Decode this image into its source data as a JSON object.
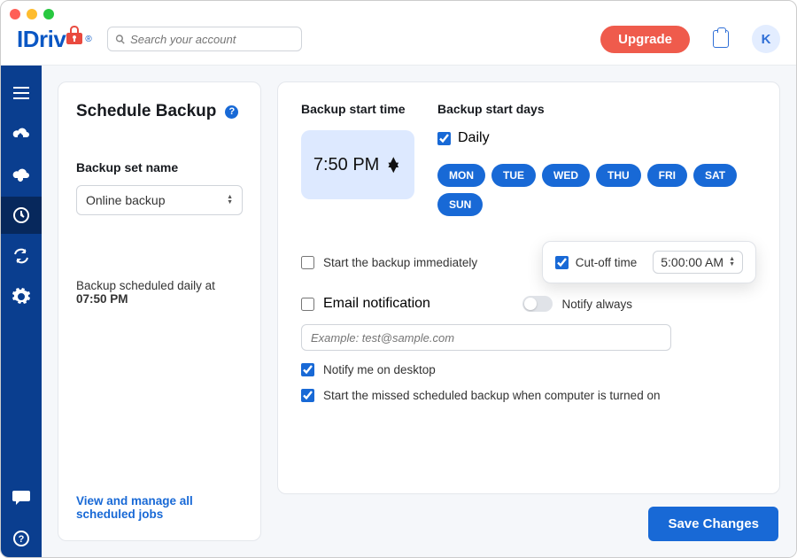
{
  "header": {
    "brand_prefix": "IDriv",
    "brand_suffix": "",
    "search_placeholder": "Search your account",
    "upgrade_label": "Upgrade",
    "avatar_initial": "K"
  },
  "sidebar": {
    "items": [
      "menu",
      "cloud-up",
      "cloud-down",
      "schedule",
      "sync",
      "settings"
    ]
  },
  "left": {
    "title": "Schedule Backup",
    "set_label": "Backup set name",
    "set_value": "Online backup",
    "sched_line1": "Backup scheduled daily at",
    "sched_time": "07:50 PM",
    "link": "View and manage all scheduled jobs"
  },
  "right": {
    "start_time_label": "Backup start time",
    "start_time": "7:50 PM",
    "start_days_label": "Backup start days",
    "daily_label": "Daily",
    "days": [
      "MON",
      "TUE",
      "WED",
      "THU",
      "FRI",
      "SAT",
      "SUN"
    ],
    "opts": {
      "start_immediately": "Start the backup immediately",
      "cutoff_label": "Cut-off time",
      "cutoff_value": "5:00:00 AM",
      "email_notification": "Email notification",
      "notify_always": "Notify always",
      "email_placeholder": "Example: test@sample.com",
      "notify_desktop": "Notify me on desktop",
      "start_missed": "Start the missed scheduled backup when computer is turned on"
    },
    "save_label": "Save Changes"
  },
  "state": {
    "daily_checked": true,
    "start_immediately": false,
    "cutoff_checked": true,
    "email_notification": false,
    "notify_always": false,
    "notify_desktop": true,
    "start_missed": true
  }
}
